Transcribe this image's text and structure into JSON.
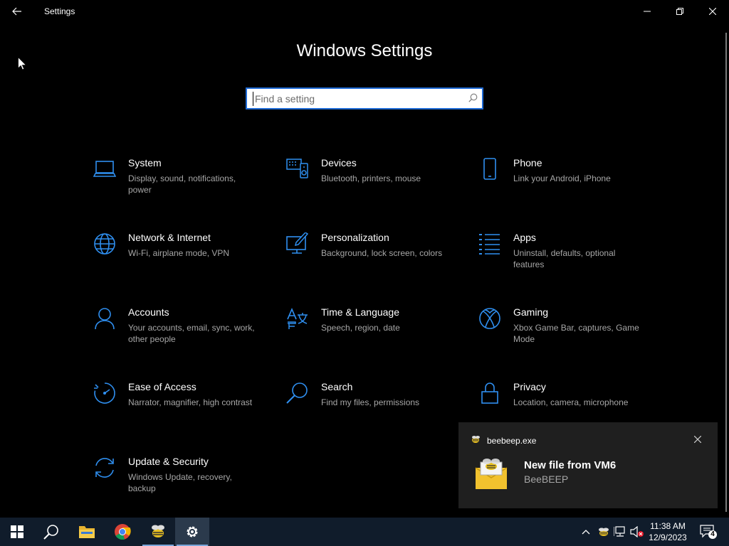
{
  "window": {
    "title": "Settings",
    "heading": "Windows Settings"
  },
  "search": {
    "placeholder": "Find a setting",
    "value": ""
  },
  "tiles": [
    {
      "name": "System",
      "desc": "Display, sound, notifications, power",
      "icon": "laptop-icon"
    },
    {
      "name": "Devices",
      "desc": "Bluetooth, printers, mouse",
      "icon": "devices-icon"
    },
    {
      "name": "Phone",
      "desc": "Link your Android, iPhone",
      "icon": "phone-icon"
    },
    {
      "name": "Network & Internet",
      "desc": "Wi-Fi, airplane mode, VPN",
      "icon": "globe-icon"
    },
    {
      "name": "Personalization",
      "desc": "Background, lock screen, colors",
      "icon": "paint-icon"
    },
    {
      "name": "Apps",
      "desc": "Uninstall, defaults, optional features",
      "icon": "apps-list-icon"
    },
    {
      "name": "Accounts",
      "desc": "Your accounts, email, sync, work, other people",
      "icon": "person-icon"
    },
    {
      "name": "Time & Language",
      "desc": "Speech, region, date",
      "icon": "language-icon"
    },
    {
      "name": "Gaming",
      "desc": "Xbox Game Bar, captures, Game Mode",
      "icon": "xbox-icon"
    },
    {
      "name": "Ease of Access",
      "desc": "Narrator, magnifier, high contrast",
      "icon": "ease-of-access-icon"
    },
    {
      "name": "Search",
      "desc": "Find my files, permissions",
      "icon": "search-icon"
    },
    {
      "name": "Privacy",
      "desc": "Location, camera, microphone",
      "icon": "lock-icon"
    },
    {
      "name": "Update & Security",
      "desc": "Windows Update, recovery, backup",
      "icon": "update-icon"
    }
  ],
  "toast": {
    "app_name": "beebeep.exe",
    "title": "New file from VM6",
    "subtitle": "BeeBEEP"
  },
  "taskbar": {
    "clock_time": "11:38 AM",
    "clock_date": "12/9/2023",
    "notification_count": "4"
  },
  "colors": {
    "accent": "#1f6bd6",
    "icon_blue": "#2f8ff0",
    "taskbar": "#101c2b",
    "toast": "#1f1f1f"
  }
}
